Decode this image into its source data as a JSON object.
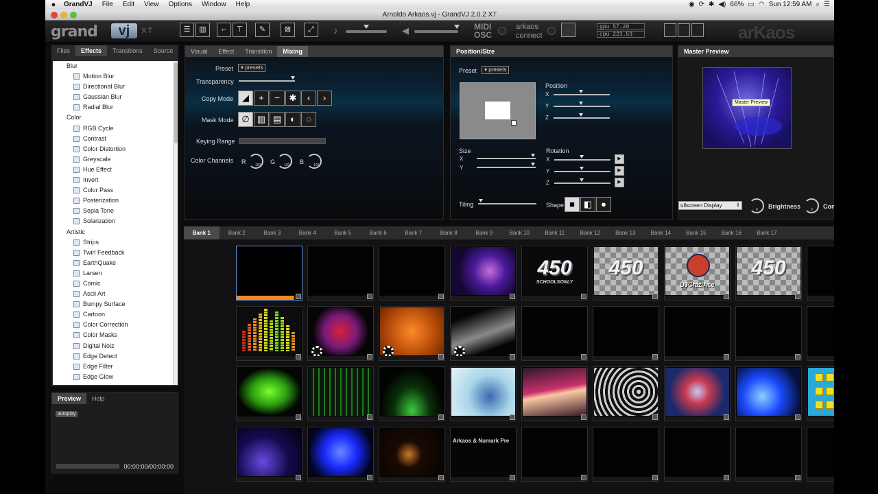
{
  "menubar": {
    "apple": "",
    "app": "GrandVJ",
    "items": [
      "File",
      "Edit",
      "View",
      "Options",
      "Window",
      "Help"
    ],
    "battery": "66%",
    "clock": "Sun 12:59 AM"
  },
  "window": {
    "title": "Arnoldo Arkaos.vj - GrandVJ 2.0.2 XT"
  },
  "toolbar": {
    "logo_grand": "grand",
    "logo_vj": "vj",
    "logo_xt": "XT",
    "midi": "MIDI",
    "osc": "OSC",
    "arkaos": "arkaos",
    "connect": "connect",
    "gpu": "gpu 57.20",
    "cpu": "cpu 223.53",
    "brand": "arKaos"
  },
  "left_tabs": [
    "Files",
    "Effects",
    "Transitions",
    "Source"
  ],
  "effects_tree": [
    {
      "type": "cat",
      "label": "Blur"
    },
    {
      "type": "eff",
      "label": "Motion Blur"
    },
    {
      "type": "eff",
      "label": "Directional Blur"
    },
    {
      "type": "eff",
      "label": "Gaussian Blur"
    },
    {
      "type": "eff",
      "label": "Radial Blur"
    },
    {
      "type": "cat",
      "label": "Color"
    },
    {
      "type": "eff",
      "label": "RGB Cycle"
    },
    {
      "type": "eff",
      "label": "Contrast"
    },
    {
      "type": "eff",
      "label": "Color Distortion"
    },
    {
      "type": "eff",
      "label": "Greyscale"
    },
    {
      "type": "eff",
      "label": "Hue Effect"
    },
    {
      "type": "eff",
      "label": "Invert"
    },
    {
      "type": "eff",
      "label": "Color Pass"
    },
    {
      "type": "eff",
      "label": "Posterization"
    },
    {
      "type": "eff",
      "label": "Sepia Tone"
    },
    {
      "type": "eff",
      "label": "Solarization"
    },
    {
      "type": "cat",
      "label": "Artistic"
    },
    {
      "type": "eff",
      "label": "Strips"
    },
    {
      "type": "eff",
      "label": "Twirl Feedback"
    },
    {
      "type": "eff",
      "label": "EarthQuake"
    },
    {
      "type": "eff",
      "label": "Larsen"
    },
    {
      "type": "eff",
      "label": "Comic"
    },
    {
      "type": "eff",
      "label": "Ascii Art"
    },
    {
      "type": "eff",
      "label": "Bumpy Surface"
    },
    {
      "type": "eff",
      "label": "Cartoon"
    },
    {
      "type": "eff",
      "label": "Color Correction"
    },
    {
      "type": "eff",
      "label": "Color Masks"
    },
    {
      "type": "eff",
      "label": "Digital Noiz"
    },
    {
      "type": "eff",
      "label": "Edge Detect"
    },
    {
      "type": "eff",
      "label": "Edge Filter"
    },
    {
      "type": "eff",
      "label": "Edge Glow"
    }
  ],
  "preview": {
    "tabs": [
      "Preview",
      "Help"
    ],
    "autoplay": "autoplay",
    "time": "00:00:00/00:00:00"
  },
  "mixing": {
    "tabs": [
      "Visual",
      "Effect",
      "Transition",
      "Mixing"
    ],
    "preset_label": "Preset",
    "preset_value": "▾ presets",
    "transparency": "Transparency",
    "copy_mode": "Copy Mode",
    "mask_mode": "Mask Mode",
    "keying_range": "Keying Range",
    "color_channels": "Color Channels",
    "r": "R",
    "g": "G",
    "b": "B",
    "knob_value": "100"
  },
  "position_size": {
    "title": "Position/Size",
    "preset_label": "Preset",
    "preset_value": "▾ presets",
    "position": "Position",
    "size": "Size",
    "rotation": "Rotation",
    "tiling": "Tiling",
    "shape": "Shape",
    "x": "X",
    "y": "Y",
    "z": "Z"
  },
  "master_preview": {
    "title": "Master Preview",
    "tooltip": "Master Preview",
    "display": "ullscreen Display",
    "brightness": "Brightness",
    "contrast": "Con",
    "knob_value": "0"
  },
  "banks": {
    "tabs": [
      "Bank 1",
      "Bank 2",
      "Bank 3",
      "Bank 4",
      "Bank 5",
      "Bank 6",
      "Bank 7",
      "Bank 8",
      "Bank 9",
      "Bank 10",
      "Bank 11",
      "Bank 12",
      "Bank 13",
      "Bank 14",
      "Bank 15",
      "Bank 16",
      "Bank 17"
    ],
    "active": 0,
    "thumb_labels": {
      "schools": "450",
      "schools_sub": "SCHOOLSONLY",
      "djname": "DJCraziAce",
      "numark": "Arkaos & Numark Pre"
    }
  }
}
